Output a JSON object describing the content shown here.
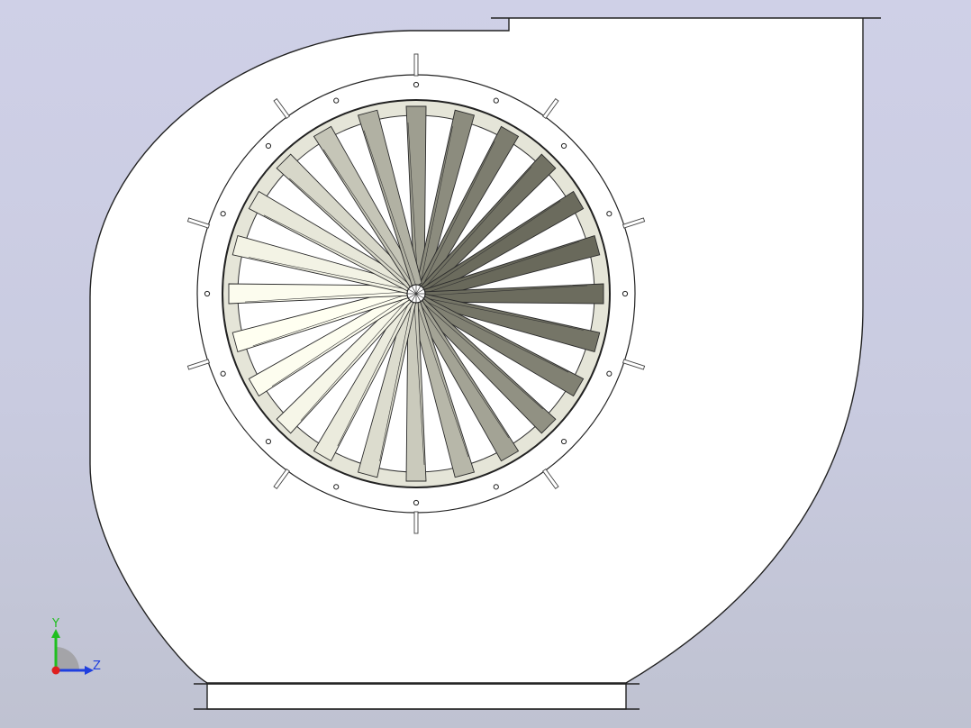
{
  "viewport": {
    "background_top": "#cfd0e7",
    "background_bottom": "#bfc2d1"
  },
  "model": {
    "type": "centrifugal-fan-housing",
    "impeller_blade_count": 24,
    "flange_bolt_count": 16,
    "outer_studs_count": 10
  },
  "triad": {
    "y_label": "Y",
    "z_label": "Z",
    "y_color": "#1fbf1f",
    "z_color": "#1f3fdf",
    "x_color": "#df1f1f"
  }
}
